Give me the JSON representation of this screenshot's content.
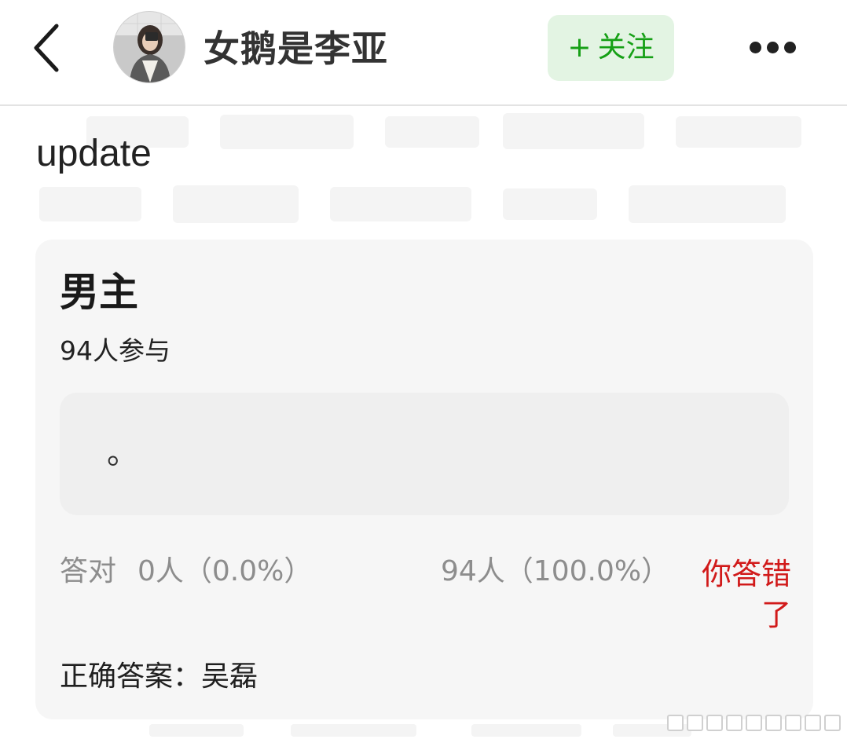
{
  "header": {
    "username": "女鹅是李亚",
    "follow_label": "关注",
    "follow_plus": "+",
    "accent_color": "#16a016"
  },
  "post": {
    "text": "update"
  },
  "quiz": {
    "title": "男主",
    "participants": "94人参与",
    "option": "。",
    "correct_label": "答对",
    "correct_value": "0人（0.0%）",
    "wrong_value": "94人（100.0%）",
    "result": "你答错了",
    "answer": "正确答案：吴磊",
    "result_color": "#d11a1a"
  }
}
